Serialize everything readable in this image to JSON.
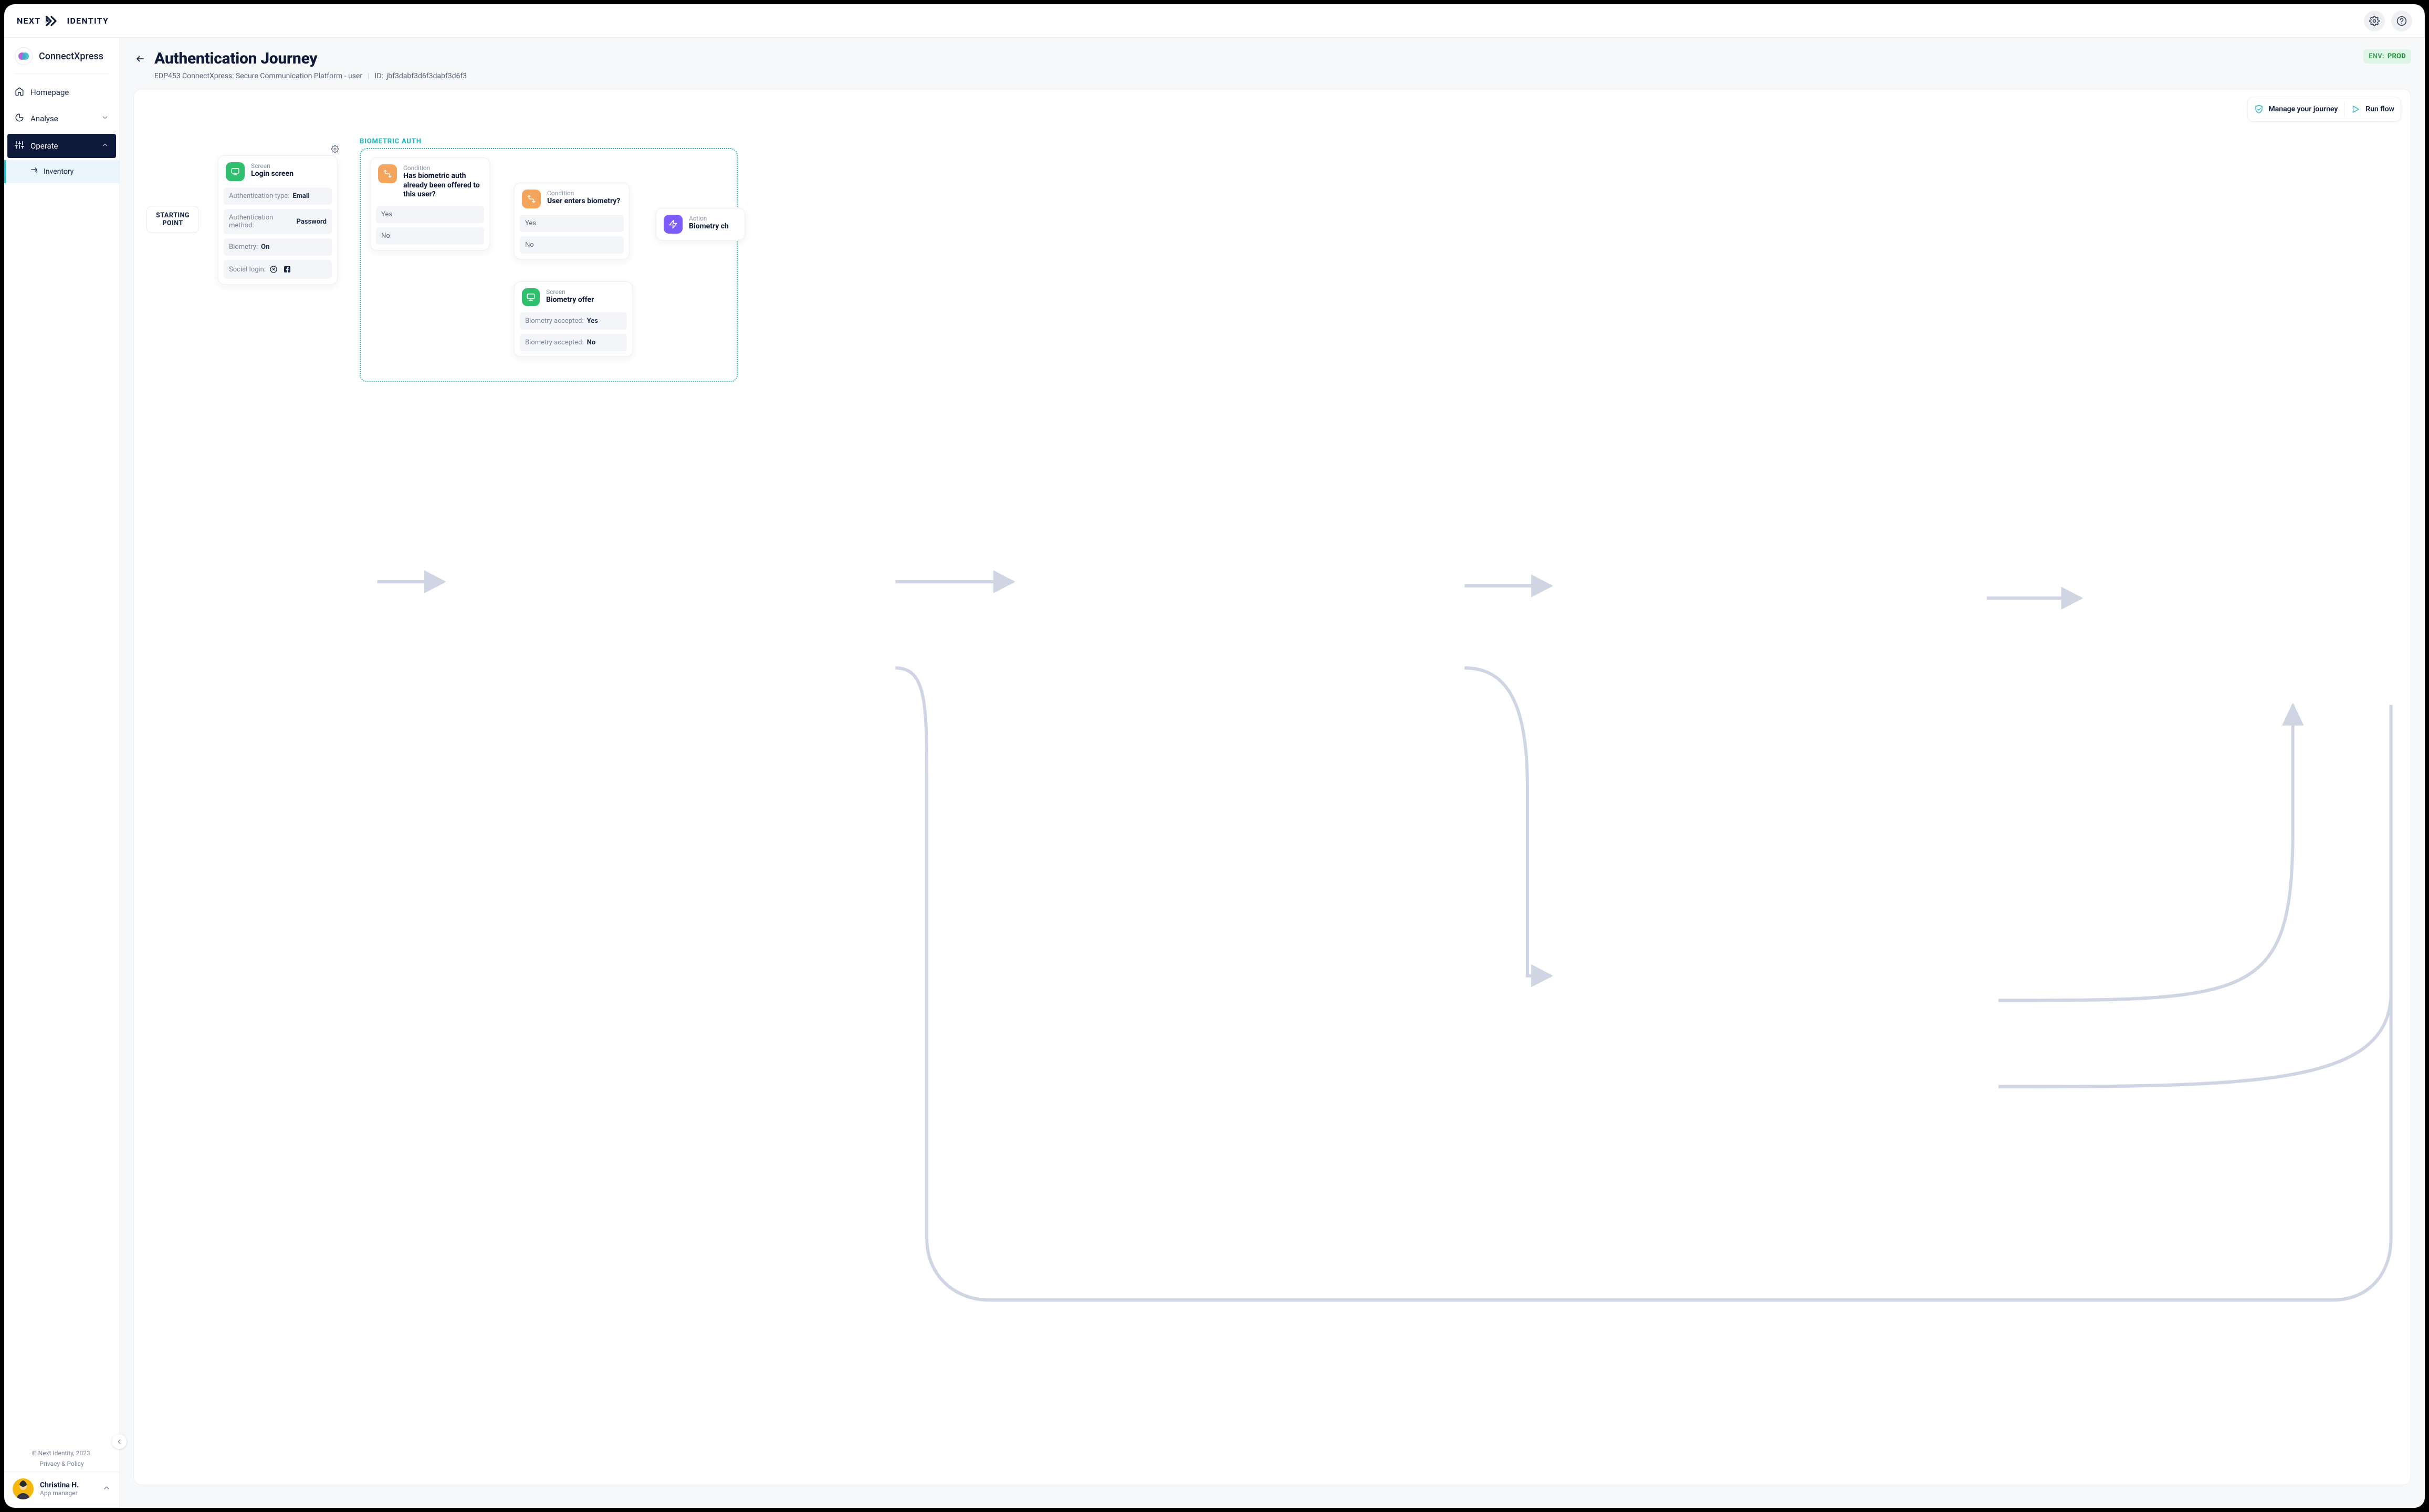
{
  "brand": {
    "left": "NEXT",
    "right": "IDENTITY"
  },
  "project": {
    "name": "ConnectXpress"
  },
  "nav": {
    "home": "Homepage",
    "analyze": "Analyse",
    "operate": "Operate",
    "inventory": "Inventory"
  },
  "footer": {
    "copyright": "© Next Identity, 2023.",
    "privacy": "Privacy & Policy"
  },
  "user": {
    "name": "Christina H.",
    "role": "App manager"
  },
  "header": {
    "title": "Authentication Journey",
    "subtitle": "EDP453 ConnectXpress: Secure Communication Platform - user",
    "id_label": "ID:",
    "id_value": "jbf3dabf3d6f3dabf3d6f3",
    "env_label": "ENV:",
    "env_value": "PROD"
  },
  "toolbar": {
    "manage": "Manage your journey",
    "run": "Run flow"
  },
  "flow": {
    "group_label": "BIOMETRIC AUTH",
    "start": "STARTING POINT",
    "login_screen": {
      "eyebrow": "Screen",
      "title": "Login screen",
      "auth_type_label": "Authentication type:",
      "auth_type_value": "Email",
      "auth_method_label": "Authentication method:",
      "auth_method_value": "Password",
      "biometry_label": "Biometry:",
      "biometry_value": "On",
      "social_label": "Social login:"
    },
    "cond1": {
      "eyebrow": "Condition",
      "title": "Has biometric auth already been offered to this user?",
      "yes": "Yes",
      "no": "No"
    },
    "cond2": {
      "eyebrow": "Condition",
      "title": "User enters biometry?",
      "yes": "Yes",
      "no": "No"
    },
    "offer": {
      "eyebrow": "Screen",
      "title": "Biometry offer",
      "row1_label": "Biometry accepted:",
      "row1_value": "Yes",
      "row2_label": "Biometry accepted:",
      "row2_value": "No"
    },
    "action": {
      "eyebrow": "Action",
      "title": "Biometry ch"
    }
  }
}
